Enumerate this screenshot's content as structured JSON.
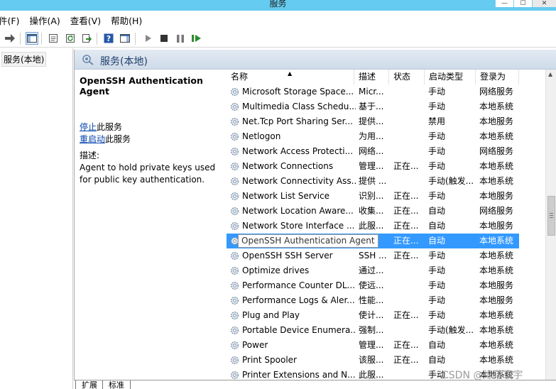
{
  "window": {
    "title": "服务",
    "minimize_glyph": "—",
    "maximize_glyph": "☐",
    "close_glyph": "✕"
  },
  "menu": [
    "件(F)",
    "操作(A)",
    "查看(V)",
    "帮助(H)"
  ],
  "tree": {
    "item": "服务(本地)"
  },
  "pane": {
    "header": "服务(本地)",
    "selected_service": "OpenSSH Authentication Agent",
    "stop_link": "停止",
    "stop_suffix": "此服务",
    "restart_link": "重启动",
    "restart_suffix": "此服务",
    "description_label": "描述:",
    "description": "Agent to hold private keys used for public key authentication."
  },
  "columns": {
    "name": "名称",
    "description": "描述",
    "status": "状态",
    "startup": "启动类型",
    "logon": "登录为",
    "sort_glyph": "▲"
  },
  "rows": [
    {
      "name": "Microsoft Storage Space...",
      "desc": "Micr...",
      "status": "",
      "startup": "手动",
      "logon": "网络服务"
    },
    {
      "name": "Multimedia Class Schedu...",
      "desc": "基于...",
      "status": "",
      "startup": "手动",
      "logon": "本地系统"
    },
    {
      "name": "Net.Tcp Port Sharing Ser...",
      "desc": "提供...",
      "status": "",
      "startup": "禁用",
      "logon": "本地服务"
    },
    {
      "name": "Netlogon",
      "desc": "为用...",
      "status": "",
      "startup": "手动",
      "logon": "本地系统"
    },
    {
      "name": "Network Access Protecti...",
      "desc": "网络...",
      "status": "",
      "startup": "手动",
      "logon": "网络服务"
    },
    {
      "name": "Network Connections",
      "desc": "管理...",
      "status": "正在...",
      "startup": "手动",
      "logon": "本地系统"
    },
    {
      "name": "Network Connectivity Ass...",
      "desc": "提供 ...",
      "status": "",
      "startup": "手动(触发...",
      "logon": "本地系统"
    },
    {
      "name": "Network List Service",
      "desc": "识别...",
      "status": "正在...",
      "startup": "手动",
      "logon": "本地服务"
    },
    {
      "name": "Network Location Aware...",
      "desc": "收集...",
      "status": "正在...",
      "startup": "自动",
      "logon": "网络服务"
    },
    {
      "name": "Network Store Interface ...",
      "desc": "此服...",
      "status": "正在...",
      "startup": "自动",
      "logon": "本地服务"
    },
    {
      "name": "OpenSSH Authentication Agent",
      "desc": "...",
      "status": "正在...",
      "startup": "自动",
      "logon": "本地系统",
      "selected": true
    },
    {
      "name": "OpenSSH SSH Server",
      "desc": "SSH ...",
      "status": "正在...",
      "startup": "手动",
      "logon": "本地系统"
    },
    {
      "name": "Optimize drives",
      "desc": "通过...",
      "status": "",
      "startup": "手动",
      "logon": "本地系统"
    },
    {
      "name": "Performance Counter DL...",
      "desc": "使远...",
      "status": "",
      "startup": "手动",
      "logon": "本地服务"
    },
    {
      "name": "Performance Logs & Aler...",
      "desc": "性能...",
      "status": "",
      "startup": "手动",
      "logon": "本地服务"
    },
    {
      "name": "Plug and Play",
      "desc": "使计...",
      "status": "正在...",
      "startup": "手动",
      "logon": "本地系统"
    },
    {
      "name": "Portable Device Enumera...",
      "desc": "强制...",
      "status": "",
      "startup": "手动(触发...",
      "logon": "本地系统"
    },
    {
      "name": "Power",
      "desc": "管理...",
      "status": "正在...",
      "startup": "自动",
      "logon": "本地系统"
    },
    {
      "name": "Print Spooler",
      "desc": "该服...",
      "status": "正在...",
      "startup": "自动",
      "logon": "本地系统"
    },
    {
      "name": "Printer Extensions and N...",
      "desc": "此服...",
      "status": "",
      "startup": "手动",
      "logon": "本地系统"
    }
  ],
  "tabs": [
    "扩展",
    "标准"
  ],
  "watermark": "CSDN @缘落寰宇",
  "colors": {
    "selection": "#3399ff",
    "titlebar": "#65cbf0",
    "link": "#0645ad",
    "header_bg": "#d7e2ee"
  }
}
